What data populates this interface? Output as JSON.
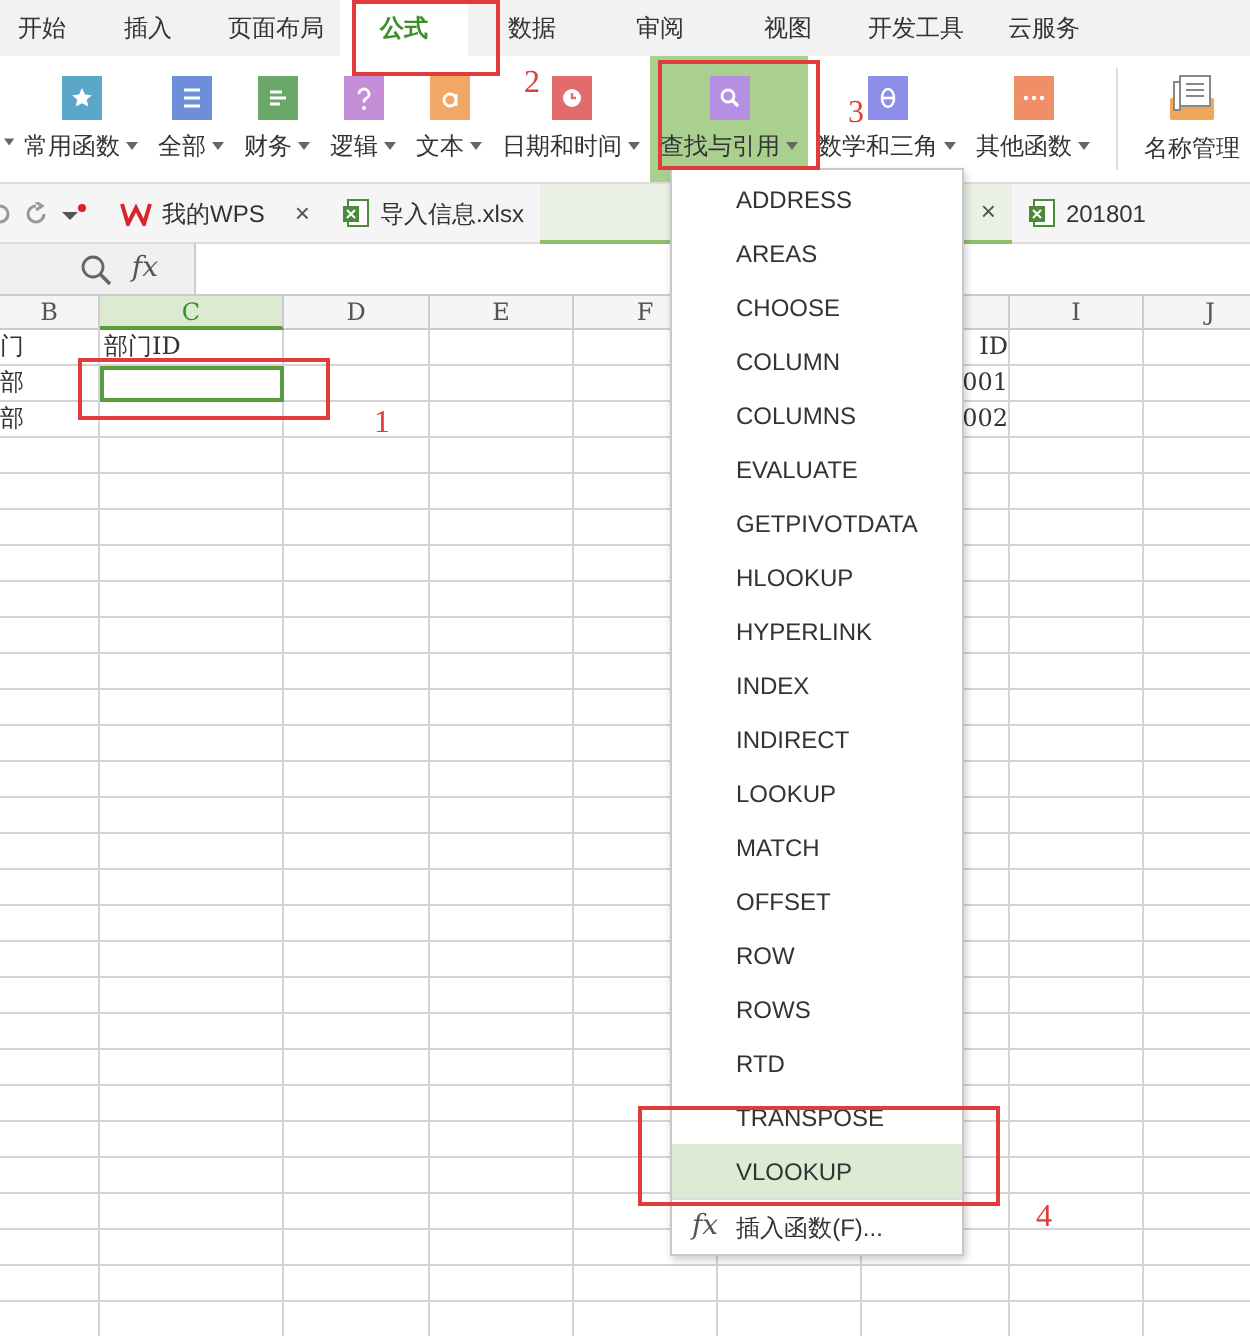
{
  "tabs": [
    {
      "label": "开始",
      "selected": false
    },
    {
      "label": "插入",
      "selected": false
    },
    {
      "label": "页面布局",
      "selected": false
    },
    {
      "label": "公式",
      "selected": true
    },
    {
      "label": "数据",
      "selected": false
    },
    {
      "label": "审阅",
      "selected": false
    },
    {
      "label": "视图",
      "selected": false
    },
    {
      "label": "开发工具",
      "selected": false
    },
    {
      "label": "云服务",
      "selected": false
    }
  ],
  "ribbon": [
    {
      "label": "常用函数",
      "color": "#5ba7c9",
      "selected": false
    },
    {
      "label": "全部",
      "color": "#6c8fd8",
      "selected": false
    },
    {
      "label": "财务",
      "color": "#6aa86a",
      "selected": false
    },
    {
      "label": "逻辑",
      "color": "#c48ed8",
      "selected": false
    },
    {
      "label": "文本",
      "color": "#f1a766",
      "selected": false
    },
    {
      "label": "日期和时间",
      "color": "#e26b6b",
      "selected": false
    },
    {
      "label": "查找与引用",
      "color": "#b48fe2",
      "selected": true
    },
    {
      "label": "数学和三角",
      "color": "#8c8ee9",
      "selected": false
    },
    {
      "label": "其他函数",
      "color": "#f08e68",
      "selected": false
    }
  ],
  "name_manager": {
    "label": "名称管理"
  },
  "document_tabs": [
    {
      "kind": "wps",
      "label": "我的WPS",
      "close": "×",
      "selected": false
    },
    {
      "kind": "sheet",
      "label": "导入信息.xlsx",
      "selected": false
    },
    {
      "kind": "blank",
      "close": "×",
      "selected": true
    },
    {
      "kind": "sheet",
      "label": "201801",
      "selected": false
    }
  ],
  "formula_bar": {
    "function_button": "fx"
  },
  "sheet": {
    "columns": [
      {
        "label": "B",
        "selected": false
      },
      {
        "label": "C",
        "selected": true
      },
      {
        "label": "D",
        "selected": false
      },
      {
        "label": "E",
        "selected": false
      },
      {
        "label": "F",
        "selected": false
      },
      {
        "selected": false
      },
      {
        "label": "I",
        "selected": false
      },
      {
        "label": "J",
        "selected": false
      }
    ],
    "rows": [
      [
        {
          "text": "门",
          "selected": false
        },
        {
          "text": "部门ID",
          "selected": false
        },
        {
          "selected": false
        },
        {
          "selected": false
        },
        {
          "selected": false
        },
        {
          "text": "ID",
          "selected": false
        },
        {
          "selected": false
        },
        {
          "selected": false
        }
      ],
      [
        {
          "text": "部",
          "selected": false
        },
        {
          "selected": true
        },
        {
          "selected": false
        },
        {
          "selected": false
        },
        {
          "selected": false
        },
        {
          "text": "001",
          "selected": false
        },
        {
          "selected": false
        },
        {
          "selected": false
        }
      ],
      [
        {
          "text": "部",
          "selected": false
        },
        {
          "selected": false
        },
        {
          "selected": false
        },
        {
          "selected": false
        },
        {
          "selected": false
        },
        {
          "text": "002",
          "selected": false
        },
        {
          "selected": false
        },
        {
          "selected": false
        }
      ]
    ]
  },
  "dropdown_menu": {
    "items": [
      {
        "label": "ADDRESS",
        "selected": false
      },
      {
        "label": "AREAS",
        "selected": false
      },
      {
        "label": "CHOOSE",
        "selected": false
      },
      {
        "label": "COLUMN",
        "selected": false
      },
      {
        "label": "COLUMNS",
        "selected": false
      },
      {
        "label": "EVALUATE",
        "selected": false
      },
      {
        "label": "GETPIVOTDATA",
        "selected": false
      },
      {
        "label": "HLOOKUP",
        "selected": false
      },
      {
        "label": "HYPERLINK",
        "selected": false
      },
      {
        "label": "INDEX",
        "selected": false
      },
      {
        "label": "INDIRECT",
        "selected": false
      },
      {
        "label": "LOOKUP",
        "selected": false
      },
      {
        "label": "MATCH",
        "selected": false
      },
      {
        "label": "OFFSET",
        "selected": false
      },
      {
        "label": "ROW",
        "selected": false
      },
      {
        "label": "ROWS",
        "selected": false
      },
      {
        "label": "RTD",
        "selected": false
      },
      {
        "label": "TRANSPOSE",
        "selected": false
      },
      {
        "label": "VLOOKUP",
        "selected": true
      }
    ],
    "footer": {
      "icon": "fx",
      "label": "插入函数(F)..."
    }
  },
  "annotations": [
    {
      "label": "2"
    },
    {
      "label": "3"
    },
    {
      "label": "1"
    },
    {
      "label": "4"
    }
  ]
}
